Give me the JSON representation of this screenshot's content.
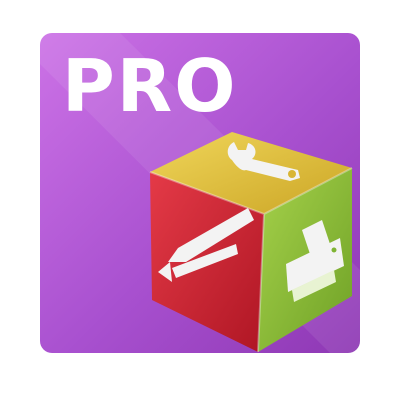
{
  "icon": {
    "title": "PRO",
    "colors": {
      "background_light": "#CC72E6",
      "background_dark": "#8E38B4",
      "top_face": "#E2C33C",
      "left_face": "#D62634",
      "right_face": "#8FC23A",
      "glyph": "#F3F3F3"
    },
    "faces": [
      {
        "name": "top",
        "icon_name": "wrench-icon"
      },
      {
        "name": "left",
        "icon_name": "pencil-icon"
      },
      {
        "name": "right",
        "icon_name": "printer-icon"
      }
    ]
  }
}
